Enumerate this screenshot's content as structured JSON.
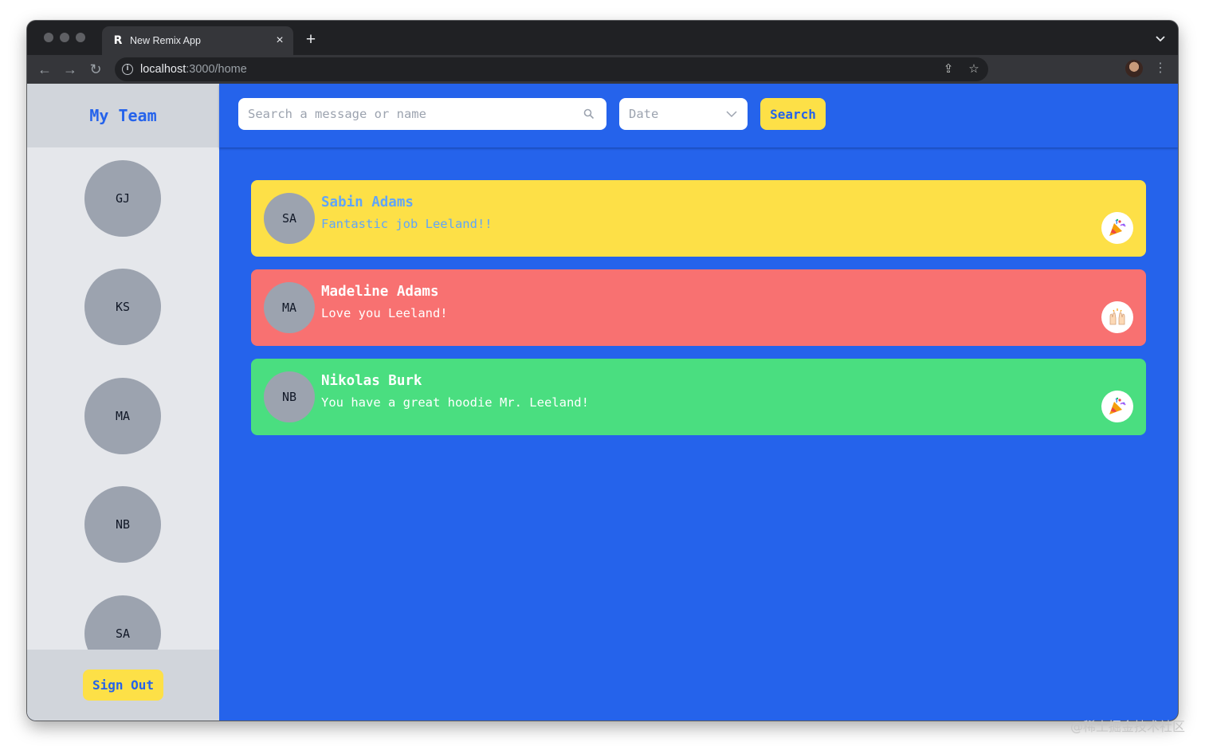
{
  "browser": {
    "tab_title": "New Remix App",
    "tab_favicon_glyph": "R",
    "tab_close_glyph": "×",
    "new_tab_glyph": "+",
    "nav_back_glyph": "←",
    "nav_forward_glyph": "→",
    "nav_reload_glyph": "↻",
    "url_host": "localhost",
    "url_rest": ":3000/home",
    "info_glyph": "i",
    "share_glyph": "⇪",
    "bookmark_glyph": "☆",
    "menu_glyph": "⋮"
  },
  "sidebar": {
    "title": "My Team",
    "members": [
      {
        "initials": "GJ"
      },
      {
        "initials": "KS"
      },
      {
        "initials": "MA"
      },
      {
        "initials": "NB"
      },
      {
        "initials": "SA"
      }
    ],
    "sign_out_label": "Sign Out"
  },
  "search": {
    "placeholder": "Search a message or name",
    "date_label": "Date",
    "button_label": "Search"
  },
  "kudos": [
    {
      "initials": "SA",
      "name": "Sabin Adams",
      "message": "Fantastic job Leeland!!",
      "emoji": "party-popper-icon",
      "background": "#fde047",
      "text_color": "#60a5fa"
    },
    {
      "initials": "MA",
      "name": "Madeline Adams",
      "message": "Love you Leeland!",
      "emoji": "raising-hands-icon",
      "background": "#f87171",
      "text_color": "#ffffff"
    },
    {
      "initials": "NB",
      "name": "Nikolas Burk",
      "message": "You have a great hoodie Mr. Leeland!",
      "emoji": "party-popper-icon",
      "background": "#4ade80",
      "text_color": "#ffffff"
    }
  ],
  "colors": {
    "primary_blue": "#2563eb",
    "accent_yellow": "#fde047",
    "avatar_gray": "#9ca3af",
    "sidebar_bg": "#e5e7eb",
    "sidebar_header_bg": "#d1d5db"
  },
  "watermark": "@稀土掘金技术社区"
}
